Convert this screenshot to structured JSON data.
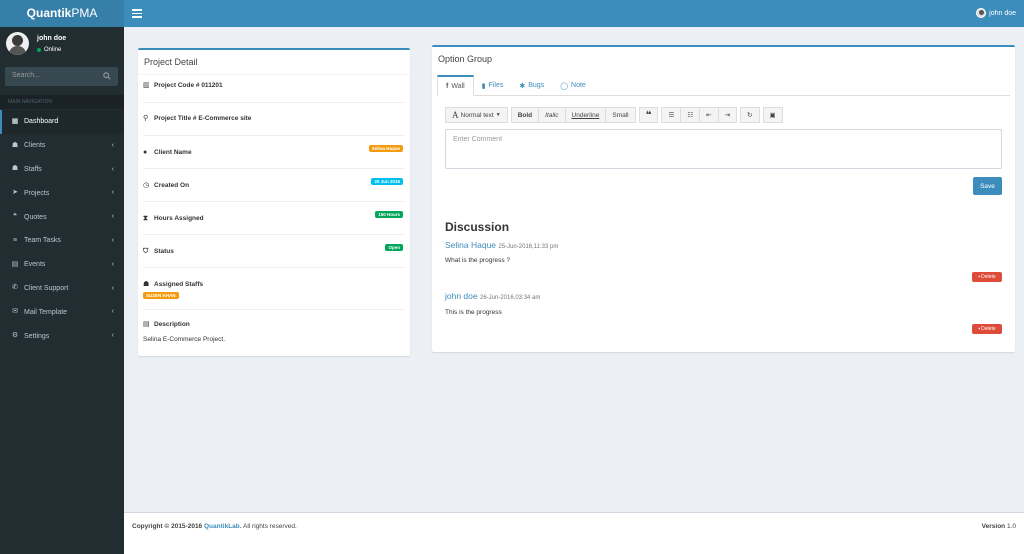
{
  "header": {
    "logo_bold": "Quantik",
    "logo_light": "PMA",
    "user_name": "john doe"
  },
  "sidebar": {
    "user_name": "john doe",
    "status": "Online",
    "search_placeholder": "Search...",
    "nav_header": "MAIN NAVIGATION",
    "items": [
      {
        "label": "Dashboard",
        "icon": "dashboard-icon",
        "active": true
      },
      {
        "label": "Clients",
        "icon": "users-icon"
      },
      {
        "label": "Staffs",
        "icon": "staff-icon"
      },
      {
        "label": "Projects",
        "icon": "paper-plane-icon"
      },
      {
        "label": "Quotes",
        "icon": "quote-icon"
      },
      {
        "label": "Team Tasks",
        "icon": "tasks-icon"
      },
      {
        "label": "Events",
        "icon": "calendar-icon"
      },
      {
        "label": "Client Support",
        "icon": "support-icon"
      },
      {
        "label": "Mail Template",
        "icon": "envelope-icon"
      },
      {
        "label": "Settings",
        "icon": "gear-icon"
      }
    ]
  },
  "project_detail": {
    "title": "Project Detail",
    "code": "Project Code # 011201",
    "project_title": "Project Title # E-Commerce site",
    "client_label": "Client Name",
    "client_value": "Selina Haque",
    "created_label": "Created On",
    "created_value": "20 Jun 2016",
    "hours_label": "Hours Assigned",
    "hours_value": "150 Hours",
    "status_label": "Status",
    "status_value": "Open",
    "staffs_label": "Assigned Staffs",
    "staffs_value": "SUZEN KHAN",
    "desc_label": "Description",
    "desc_value": "Selina E-Commerce Project."
  },
  "option_group": {
    "title": "Option Group",
    "tabs": [
      "Wall",
      "Files",
      "Bugs",
      "Note"
    ],
    "toolbar": {
      "normal_text": "Normal text",
      "bold": "Bold",
      "italic": "Italic",
      "underline": "Underline",
      "small": "Small"
    },
    "comment_placeholder": "Enter Comment",
    "save": "Save",
    "discussion_title": "Discussion",
    "posts": [
      {
        "author": "Selina Haque",
        "date": "25-Jun-2016,11:33 pm",
        "body": "What is the progress ?",
        "delete": "Delete"
      },
      {
        "author": "john doe",
        "date": "26-Jun-2016,03:34 am",
        "body": "This is the progress",
        "delete": "Delete"
      }
    ]
  },
  "footer": {
    "copyright_prefix": "Copyright © 2015-2016",
    "company": "QuantikLab.",
    "rights": "All rights reserved.",
    "version_label": "Version",
    "version_value": "1.0"
  },
  "colors": {
    "accent": "#3c8dbc",
    "sidebar_bg": "#222d32",
    "badge_orange": "#f39c12",
    "badge_cyan": "#00c0ef",
    "badge_green": "#00a65a",
    "delete_red": "#dd4b39"
  }
}
